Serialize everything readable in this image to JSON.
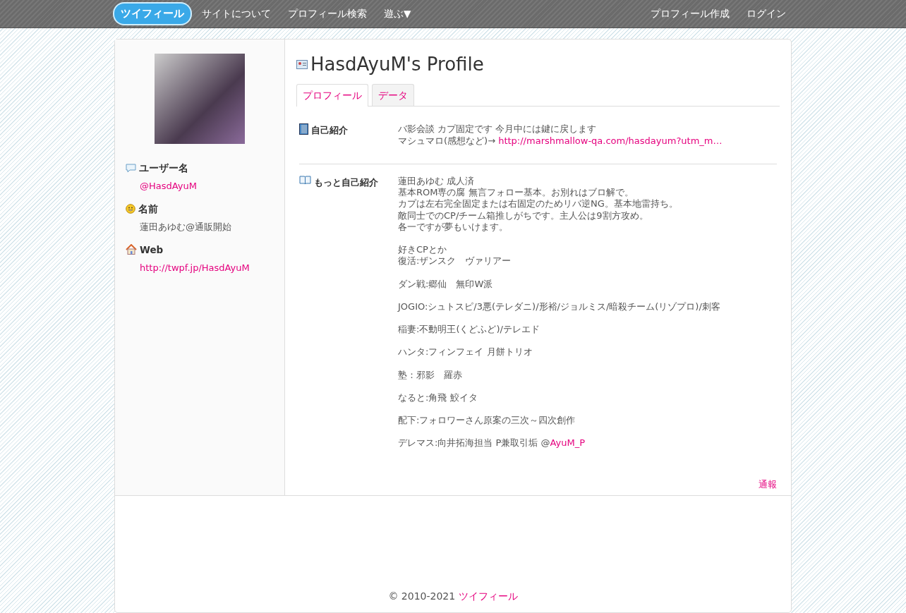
{
  "navbar": {
    "logo": "ツイフィール",
    "links": [
      "サイトについて",
      "プロフィール検索",
      "遊ぶ▼"
    ],
    "right_links": [
      "プロフィール作成",
      "ログイン"
    ]
  },
  "sidebar": {
    "fields": [
      {
        "kind": "user",
        "label": "ユーザー名",
        "value": "@HasdAyuM",
        "is_link": true
      },
      {
        "kind": "name",
        "label": "名前",
        "value": "蓮田あゆむ@通販開始",
        "is_link": false
      },
      {
        "kind": "web",
        "label": "Web",
        "value": "http://twpf.jp/HasdAyuM",
        "is_link": true
      }
    ]
  },
  "profile": {
    "title": "HasdAyuM's Profile",
    "tabs": [
      {
        "label": "プロフィール",
        "selected": true
      },
      {
        "label": "データ",
        "selected": false
      }
    ],
    "sections": [
      {
        "kind": "intro",
        "label": "自己紹介",
        "paragraphs": [
          [
            {
              "text": "バ影会談 カプ固定です 今月中には鍵に戻します"
            },
            {
              "text": "マシュマロ(感想など)→ ",
              "link": "http://marshmallow-qa.com/hasdayum?utm_m…"
            }
          ]
        ]
      },
      {
        "kind": "more",
        "label": "もっと自己紹介",
        "paragraphs": [
          [
            {
              "text": "蓮田あゆむ 成人済"
            },
            {
              "text": "基本ROM専の腐 無言フォロー基本。お別れはブロ解で。"
            },
            {
              "text": "カプは左右完全固定または右固定のためリバ逆NG。基本地雷持ち。"
            },
            {
              "text": "敵同士でのCP/チーム箱推しがちです。主人公は9割方攻め。"
            },
            {
              "text": "各一ですが夢もいけます。"
            }
          ],
          [
            {
              "text": "好きCPとか"
            },
            {
              "text": "復活:ザンスク　ヴァリアー"
            }
          ],
          [
            {
              "text": "ダン戦:郷仙　無印W派"
            }
          ],
          [
            {
              "text": "JOGIO:シュトスピ/3悪(テレダニ)/形裕/ジョルミス/暗殺チーム(リゾプロ)/刺客"
            }
          ],
          [
            {
              "text": "稲妻:不動明王(くどふど)/テレエド"
            }
          ],
          [
            {
              "text": "ハンタ:フィンフェイ 月餅トリオ"
            }
          ],
          [
            {
              "text": "塾：邪影　羅赤"
            }
          ],
          [
            {
              "text": "なると:角飛 鮫イタ"
            }
          ],
          [
            {
              "text": "配下:フォロワーさん原案の三次～四次創作"
            }
          ],
          [
            {
              "text": "デレマス:向井拓海担当 P兼取引垢 @",
              "link": "AyuM_P"
            }
          ]
        ]
      }
    ],
    "report": "通報"
  },
  "footer": {
    "copyright": "© 2010-2021 ",
    "link": "ツイフィール"
  }
}
